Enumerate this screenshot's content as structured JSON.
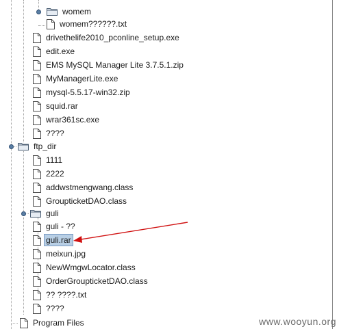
{
  "tree": {
    "items": [
      {
        "kind": "folder",
        "label": "womem"
      },
      {
        "kind": "file",
        "label": "womem??????.txt"
      },
      {
        "kind": "file",
        "label": "drivethelife2010_pconline_setup.exe"
      },
      {
        "kind": "file",
        "label": "edit.exe"
      },
      {
        "kind": "file",
        "label": "EMS MySQL Manager Lite 3.7.5.1.zip"
      },
      {
        "kind": "file",
        "label": "MyManagerLite.exe"
      },
      {
        "kind": "file",
        "label": "mysql-5.5.17-win32.zip"
      },
      {
        "kind": "file",
        "label": "squid.rar"
      },
      {
        "kind": "file",
        "label": "wrar361sc.exe"
      },
      {
        "kind": "file",
        "label": "????"
      },
      {
        "kind": "folder",
        "label": "ftp_dir"
      },
      {
        "kind": "file",
        "label": "1111"
      },
      {
        "kind": "file",
        "label": "2222"
      },
      {
        "kind": "file",
        "label": "addwstmengwang.class"
      },
      {
        "kind": "file",
        "label": "GroupticketDAO.class"
      },
      {
        "kind": "folder",
        "label": "guli"
      },
      {
        "kind": "file",
        "label": "guli - ??"
      },
      {
        "kind": "file",
        "label": "guli.rar",
        "selected": true
      },
      {
        "kind": "file",
        "label": "meixun.jpg"
      },
      {
        "kind": "file",
        "label": "NewWmgwLocator.class"
      },
      {
        "kind": "file",
        "label": "OrderGroupticketDAO.class"
      },
      {
        "kind": "file",
        "label": "?? ????.txt"
      },
      {
        "kind": "file",
        "label": "????"
      },
      {
        "kind": "file",
        "label": "Program Files"
      }
    ]
  },
  "watermark": "www.wooyun.org",
  "colors": {
    "selection": "#b8cfe5",
    "arrow": "#d01010",
    "folder": "#9fb5cc",
    "knob": "#5b7fa5"
  },
  "icons": {
    "file": "document-icon",
    "folder": "folder-icon",
    "expand": "expanded-node-handle-icon"
  }
}
